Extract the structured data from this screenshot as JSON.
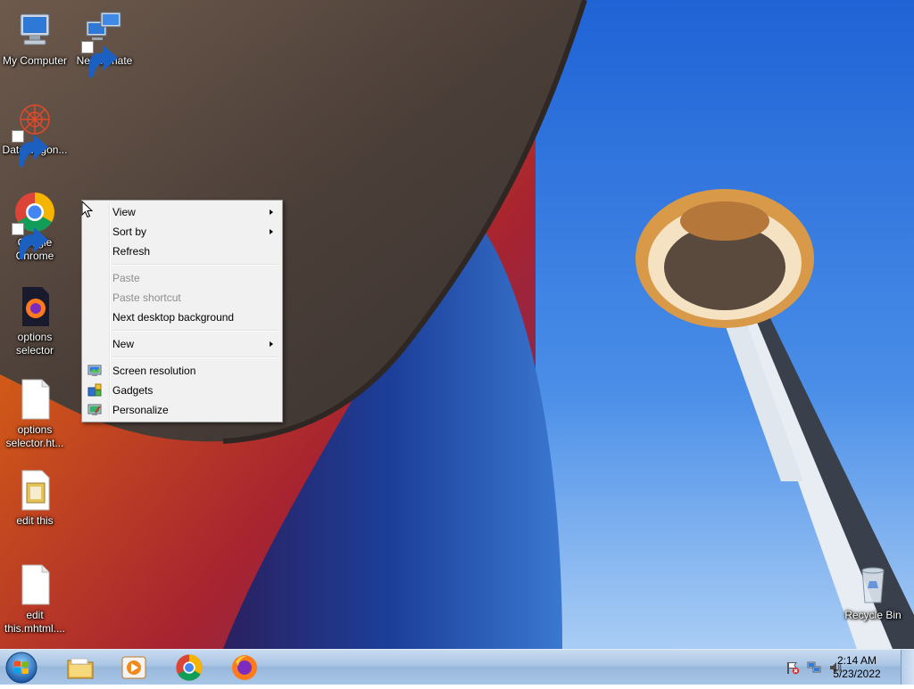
{
  "desktop": {
    "icons": [
      {
        "label": "My Computer",
        "icon": "computer-icon"
      },
      {
        "label": "NetAnimate",
        "icon": "network-computers-icon"
      },
      {
        "label": "DataWagon...",
        "icon": "datawagon-icon"
      },
      {
        "label": "Google Chrome",
        "icon": "chrome-icon"
      },
      {
        "label": "options selector",
        "icon": "firefox-file-icon"
      },
      {
        "label": "options selector.ht...",
        "icon": "blank-file-icon"
      },
      {
        "label": "edit this",
        "icon": "image-file-icon"
      },
      {
        "label": "edit this.mhtml....",
        "icon": "blank-file-icon"
      },
      {
        "label": "Recycle Bin",
        "icon": "recycle-bin-icon"
      }
    ]
  },
  "context_menu": {
    "view": "View",
    "sort_by": "Sort by",
    "refresh": "Refresh",
    "paste": "Paste",
    "paste_shortcut": "Paste shortcut",
    "next_background": "Next desktop background",
    "new": "New",
    "screen_resolution": "Screen resolution",
    "gadgets": "Gadgets",
    "personalize": "Personalize"
  },
  "taskbar": {
    "pinned": [
      "file-explorer-icon",
      "media-player-icon",
      "chrome-icon",
      "firefox-icon"
    ],
    "clock_time": "2:14 AM",
    "clock_date": "5/23/2022"
  },
  "colors": {
    "menu_bg": "#f1f1f1",
    "disabled_text": "#8d8d8d",
    "taskbar_top": "#c9dcf0"
  }
}
